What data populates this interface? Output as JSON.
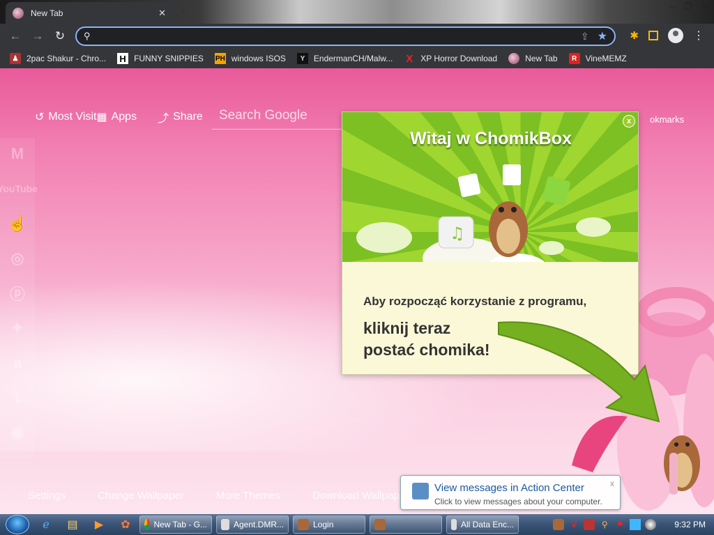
{
  "browser": {
    "tab_title": "New Tab",
    "tab_close": "✕",
    "new_tab": "+",
    "window_controls": [
      "–",
      "❐",
      "✕"
    ],
    "omnibox_value": ""
  },
  "bookmarks": [
    {
      "label": "2pac Shakur - Chro...",
      "icon": "2pac-icon"
    },
    {
      "label": "FUNNY SNIPPIES",
      "icon": "h-logo-icon",
      "glyph": "H"
    },
    {
      "label": "windows ISOS",
      "icon": "ph-logo-icon",
      "glyph": "PH"
    },
    {
      "label": "EndermanCH/Malw...",
      "icon": "yp-logo-icon",
      "glyph": "Y"
    },
    {
      "label": "XP Horror Download",
      "icon": "x-logo-icon",
      "glyph": "X"
    },
    {
      "label": "New Tab",
      "icon": "newtab-favicon"
    },
    {
      "label": "VineMEMZ",
      "icon": "r-logo-icon",
      "glyph": "R"
    }
  ],
  "newtab": {
    "most_visited": "Most Visit",
    "apps": "Apps",
    "share": "Share",
    "search_placeholder": "Search Google",
    "bookmarks_link": "okmarks",
    "side_icons": [
      "gmail-icon",
      "youtube-icon",
      "cursor-icon",
      "instagram-icon",
      "pinterest-icon",
      "twitter-icon",
      "amazon-icon",
      "tumblr-icon",
      "reddit-icon"
    ],
    "youtube_text": "YouTube",
    "bottom_links": [
      "Settings",
      "Change Wallpaper",
      "More Themes",
      "Download Wallpap"
    ]
  },
  "popup": {
    "title": "Witaj w ChomikBox",
    "close": "x",
    "line1": "Aby rozpocząć korzystanie z programu,",
    "line2": "kliknij teraz postać chomika!"
  },
  "balloon": {
    "title": "View messages in Action Center",
    "subtitle": "Click to view messages about your computer.",
    "close": "x"
  },
  "taskbar": {
    "tasks": [
      {
        "label": "New Tab - G...",
        "icon": "chrome-icon"
      },
      {
        "label": "Agent.DMR...",
        "icon": "window-icon"
      },
      {
        "label": "Login",
        "icon": "chomik-icon"
      },
      {
        "label": "",
        "icon": "chomik-icon"
      },
      {
        "label": "All Data Enc...",
        "icon": "window-icon"
      }
    ],
    "clock": "9:32 PM"
  },
  "colors": {
    "chrome_dark": "#35363a",
    "omnibox_focus": "#8ab4f8",
    "popup_green": "#7cc023",
    "page_pink": "#f27fb2"
  }
}
